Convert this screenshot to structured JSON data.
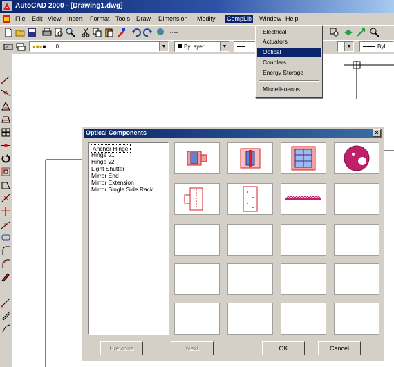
{
  "window": {
    "title": "AutoCAD 2000 - [Drawing1.dwg]"
  },
  "menubar": {
    "items": [
      {
        "label": "File"
      },
      {
        "label": "Edit"
      },
      {
        "label": "View"
      },
      {
        "label": "Insert"
      },
      {
        "label": "Format"
      },
      {
        "label": "Tools"
      },
      {
        "label": "Draw"
      },
      {
        "label": "Dimension"
      },
      {
        "label": "Modify"
      },
      {
        "label": "CompLib"
      },
      {
        "label": "Window"
      },
      {
        "label": "Help"
      }
    ]
  },
  "layers_toolbar": {
    "layer_value": "0",
    "color_value": "ByLayer",
    "linetype_value": "ByL"
  },
  "complib_menu": {
    "items": [
      {
        "label": "Electrical"
      },
      {
        "label": "Actuators"
      },
      {
        "label": "Optical"
      },
      {
        "label": "Couplers"
      },
      {
        "label": "Energy Storage"
      },
      {
        "label": "Miscellaneous"
      }
    ],
    "selected": "Optical"
  },
  "dialog": {
    "title": "Optical Components",
    "close_label": "×",
    "list": [
      {
        "label": "Anchor Hinge"
      },
      {
        "label": "Hinge v1"
      },
      {
        "label": "Hinge v2"
      },
      {
        "label": "Light Shutter"
      },
      {
        "label": "Mirror End"
      },
      {
        "label": "Mirror Extension"
      },
      {
        "label": "Mirror Single Side Rack"
      }
    ],
    "selected_item": "Anchor Hinge",
    "buttons": {
      "previous": "Previous",
      "next": "Next",
      "ok": "OK",
      "cancel": "Cancel"
    }
  },
  "colors": {
    "title_blue": "#0a246a",
    "face": "#d4d0c8",
    "component_red": "#d42020",
    "component_blue": "#6a7fd0",
    "component_magenta": "#c0206a"
  }
}
